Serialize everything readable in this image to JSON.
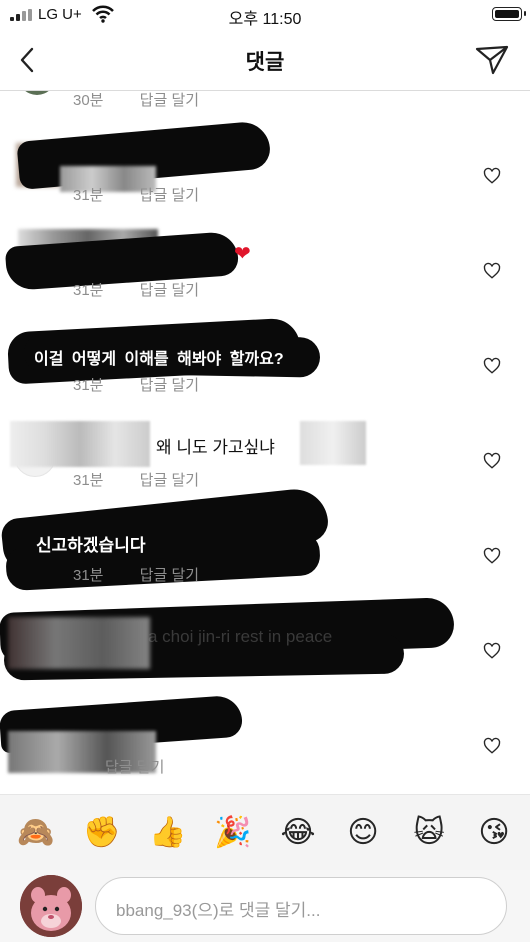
{
  "status_bar": {
    "carrier": "LG U+",
    "time": "오후 11:50"
  },
  "header": {
    "title": "댓글"
  },
  "comments": [
    {
      "time": "30분",
      "reply": "답글 달기",
      "text": ""
    },
    {
      "time": "31분",
      "reply": "답글 달기",
      "text": ""
    },
    {
      "time": "31분",
      "reply": "답글 달기",
      "text": ""
    },
    {
      "time": "31분",
      "reply": "답글 달기",
      "text": "이걸 어떻게 이해를 해봐야 할까요?"
    },
    {
      "time": "31분",
      "reply": "답글 달기",
      "text": "왜 니도 가고싶냐"
    },
    {
      "time": "31분",
      "reply": "답글 달기",
      "text": "신고하겠습니다"
    },
    {
      "time": "",
      "reply": "",
      "text": "a choi jin-ri rest in peace"
    },
    {
      "time": "",
      "reply": "답글 달기",
      "text": ""
    }
  ],
  "emoji_bar": [
    "🙈",
    "✊",
    "👍",
    "🎉",
    "😂",
    "😊",
    "🙀",
    "😘"
  ],
  "composer": {
    "placeholder": "bbang_93(으)로 댓글 달기..."
  },
  "colors": {
    "ink": "#0a0a0a",
    "meta": "#8e8e8e",
    "heart": "#262626",
    "border": "#dbdbdb"
  }
}
